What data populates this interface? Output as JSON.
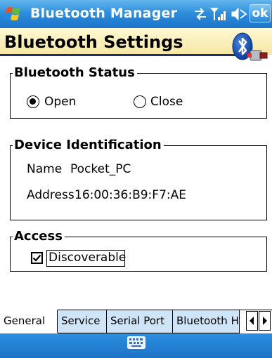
{
  "titlebar": {
    "app_title": "Bluetooth Manager",
    "ok_label": "ok",
    "icons": [
      "windows-start-icon",
      "connectivity-icon",
      "signal-strength-icon",
      "speaker-icon"
    ]
  },
  "header": {
    "page_title": "Bluetooth Settings",
    "logo": "bluetooth-logo-icon"
  },
  "bluetooth_status": {
    "group_label": "Bluetooth Status",
    "options": [
      {
        "label": "Open",
        "selected": true
      },
      {
        "label": "Close",
        "selected": false
      }
    ]
  },
  "device_identification": {
    "group_label": "Device Identification",
    "name_label": "Name",
    "name_value": "Pocket_PC",
    "address_label": "Address",
    "address_value": "16:00:36:B9:F7:AE"
  },
  "access": {
    "group_label": "Access",
    "discoverable_label": "Discoverable",
    "discoverable_checked": true
  },
  "tabs": [
    {
      "label": "General",
      "active": true
    },
    {
      "label": "Service",
      "active": false
    },
    {
      "label": "Serial Port",
      "active": false
    },
    {
      "label": "Bluetooth H",
      "active": false
    }
  ],
  "bottombar": {
    "icon": "keyboard-icon"
  },
  "colors": {
    "titlebar_blue": "#2f8fdc",
    "header_cream": "#f6e7a3",
    "header_rule": "#1f2f6f",
    "inactive_tab": "#cfe4f6"
  }
}
